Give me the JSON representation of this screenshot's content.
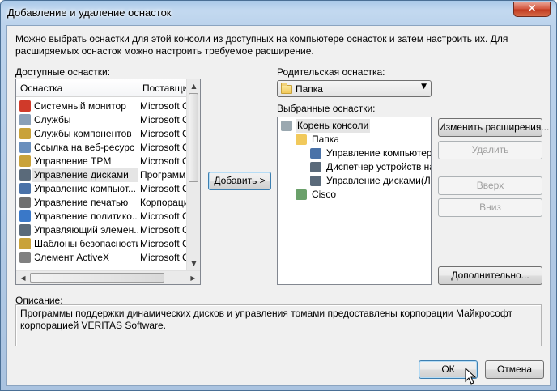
{
  "window": {
    "title": "Добавление и удаление оснасток",
    "close_glyph": "✕"
  },
  "intro_text": "Можно выбрать оснастки для этой консоли из доступных на компьютере оснасток и затем настроить их. Для расширяемых оснасток можно настроить требуемое расширение.",
  "available": {
    "label": "Доступные оснастки:",
    "columns": [
      "Оснастка",
      "Поставщик"
    ],
    "items": [
      {
        "name": "Системный монитор",
        "vendor": "Microsoft C",
        "icon": "system-monitor-icon",
        "color": "#d03a2a"
      },
      {
        "name": "Службы",
        "vendor": "Microsoft C",
        "icon": "services-gear-icon",
        "color": "#8aa0b8"
      },
      {
        "name": "Службы компонентов",
        "vendor": "Microsoft C",
        "icon": "component-services-icon",
        "color": "#c9a23a"
      },
      {
        "name": "Ссылка на веб-ресурс",
        "vendor": "Microsoft C",
        "icon": "web-link-icon",
        "color": "#6a8fbd"
      },
      {
        "name": "Управление TPM",
        "vendor": "Microsoft C",
        "icon": "tpm-chip-icon",
        "color": "#c9a23a"
      },
      {
        "name": "Управление дисками",
        "vendor": "Программн",
        "icon": "disk-management-icon",
        "color": "#5a6a7a",
        "selected": true
      },
      {
        "name": "Управление компьют...",
        "vendor": "Microsoft C",
        "icon": "computer-management-icon",
        "color": "#4a72a8"
      },
      {
        "name": "Управление печатью",
        "vendor": "Корпорация",
        "icon": "printer-icon",
        "color": "#707070"
      },
      {
        "name": "Управление политико...",
        "vendor": "Microsoft C",
        "icon": "policy-icon",
        "color": "#3a78c8"
      },
      {
        "name": "Управляющий элемен...",
        "vendor": "Microsoft C",
        "icon": "wmi-control-icon",
        "color": "#5a6a7a"
      },
      {
        "name": "Шаблоны безопасности",
        "vendor": "Microsoft C",
        "icon": "security-templates-icon",
        "color": "#c9a23a"
      },
      {
        "name": "Элемент ActiveX",
        "vendor": "Microsoft C",
        "icon": "activex-icon",
        "color": "#808080"
      }
    ]
  },
  "add_button": "Добавить >",
  "parent": {
    "label": "Родительская оснастка:",
    "value": "Папка"
  },
  "selected": {
    "label": "Выбранные оснастки:",
    "tree": [
      {
        "text": "Корень консоли",
        "level": 0,
        "icon": "console-root-folder-icon",
        "selected": true
      },
      {
        "text": "Папка",
        "level": 1,
        "icon": "folder-icon"
      },
      {
        "text": "Управление компьютером",
        "level": 2,
        "icon": "computer-management-icon"
      },
      {
        "text": "Диспетчер устройств на л",
        "level": 2,
        "icon": "device-manager-icon"
      },
      {
        "text": "Управление дисками(Лока",
        "level": 2,
        "icon": "disk-management-icon"
      },
      {
        "text": "Cisco",
        "level": 1,
        "icon": "cisco-snapin-icon"
      }
    ]
  },
  "side_buttons": {
    "edit_extensions": "Изменить расширения...",
    "remove": "Удалить",
    "up": "Вверх",
    "down": "Вниз",
    "advanced": "Дополнительно..."
  },
  "description": {
    "label": "Описание:",
    "text": "Программы поддержки динамических дисков и управления томами предоставлены корпорации Майкрософт корпорацией VERITAS Software."
  },
  "footer": {
    "ok": "ОК",
    "cancel": "Отмена"
  }
}
